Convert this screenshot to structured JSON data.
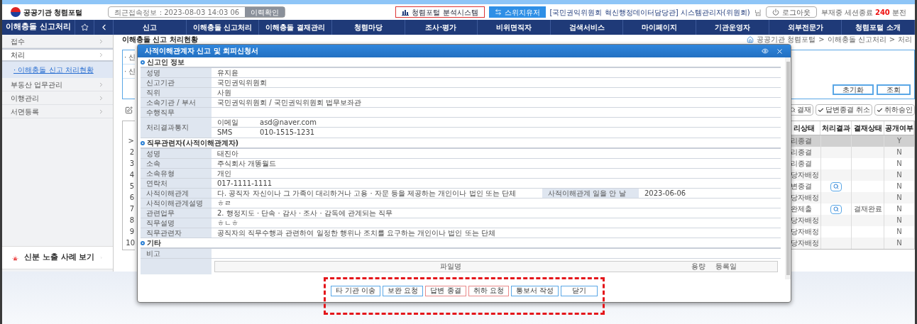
{
  "header": {
    "logo": "공공기관 청렴포털",
    "last_login": "최근접속정보 : 2023-08-03 14:03 06",
    "history_button": "이력확인",
    "analysis_button": "청렴포털 분석시스템",
    "switch_button": "스위치유저",
    "user": "[국민권익위원회 혁신행정데이터담당관] 시스템관리자(위원회)",
    "user_suffix": "님",
    "logout_button": "로그아웃",
    "session_prefix": "부재중 세션종료",
    "session_minutes": "240",
    "session_suffix": "분전"
  },
  "nav": {
    "section_title": "이해충돌 신고처리",
    "items": [
      "신고",
      "이해충돌 신고처리",
      "이해충돌 결재관리",
      "청렴마당",
      "조사·평가",
      "비위면직자",
      "검색서비스",
      "마이페이지",
      "기관운영자",
      "외부전문가",
      "청렴포털 소개"
    ]
  },
  "sidebar": {
    "items": [
      {
        "label": "접수",
        "selected": false
      },
      {
        "label": "처리",
        "selected": true,
        "children": [
          {
            "label": "· 이해충돌 신고 처리현황",
            "selected": true
          }
        ]
      },
      {
        "label": "부동산 업무관리",
        "selected": false
      },
      {
        "label": "이행관리",
        "selected": false
      },
      {
        "label": "서면등록",
        "selected": false
      }
    ],
    "exposure_link": "신분 노출 사례 보기"
  },
  "page": {
    "title": "이해충돌 신고 처리현황",
    "breadcrumb": [
      "공공기관 청렴포털",
      "이해충돌 신고처리",
      "처리"
    ],
    "separator": ">"
  },
  "search": {
    "labels": [
      "· 신",
      "· 신"
    ],
    "buttons": [
      "초기화",
      "조회"
    ]
  },
  "toolbar": [
    {
      "kind": "approve",
      "label": "결재"
    },
    {
      "kind": "check",
      "label": "답변종결 취소"
    },
    {
      "kind": "check",
      "label": "취하승인"
    }
  ],
  "table": {
    "columns": [
      "리상태",
      "처리결과",
      "결재상태",
      "공개여부"
    ],
    "rows": [
      {
        "number": ">",
        "status": "리종결",
        "has_result": false,
        "approval": "",
        "public": "Y",
        "selected": true
      },
      {
        "number": "2",
        "status": "리종결",
        "has_result": false,
        "public": "N",
        "selected": false
      },
      {
        "number": "3",
        "status": "리종결",
        "has_result": false,
        "public": "N",
        "selected": false
      },
      {
        "number": "4",
        "status": "당자배정",
        "has_result": false,
        "public": "N",
        "selected": false
      },
      {
        "number": "5",
        "status": "변종결",
        "has_result": true,
        "public": "N",
        "selected": false
      },
      {
        "number": "6",
        "status": "당자배정",
        "has_result": false,
        "public": "N",
        "selected": false
      },
      {
        "number": "7",
        "status": "완제출",
        "has_result": true,
        "approval": "결재완료",
        "public": "N",
        "selected": false
      },
      {
        "number": "8",
        "status": "당자배정",
        "has_result": false,
        "public": "N",
        "selected": false
      },
      {
        "number": "9",
        "status": "당자배정",
        "has_result": false,
        "public": "N",
        "selected": false
      },
      {
        "number": "10",
        "status": "당자배정",
        "has_result": false,
        "public": "N",
        "selected": false
      }
    ]
  },
  "modal": {
    "title": "사적이해관계자 신고 및 회피신청서",
    "sections": [
      {
        "title": "신고인 정보",
        "rows": [
          {
            "kind": "text",
            "label": "성명",
            "value": "유지윤"
          },
          {
            "kind": "text",
            "label": "신고기관",
            "value": "국민권익위원회"
          },
          {
            "kind": "text",
            "label": "직위",
            "value": "사원"
          },
          {
            "kind": "text",
            "label": "소속기관 / 부서",
            "value": "국민권익위원회 / 국민권익위원회 법무보좌관"
          },
          {
            "kind": "text",
            "label": "수행직무"
          },
          {
            "kind": "contact",
            "label": "처리결과통지",
            "items": [
              {
                "label": "이메일",
                "value": "asd@naver.com"
              },
              {
                "label": "SMS",
                "value": "010-1515-1231"
              }
            ]
          }
        ]
      },
      {
        "title": "직무관련자(사적이해관계자)",
        "rows": [
          {
            "kind": "text",
            "label": "성명",
            "value": "태진아"
          },
          {
            "kind": "text",
            "label": "소속",
            "value": "주식회사 개똥월드"
          },
          {
            "kind": "text",
            "label": "소속유형",
            "value": "개인"
          },
          {
            "kind": "text",
            "label": "연락처",
            "value": "017-1111-1111"
          },
          {
            "kind": "split",
            "label": "사적이해관계",
            "value": "다. 공직자 자신이나 그 가족이 대리하거나 고용 · 자문 등을 제공하는 개인이나 법인 또는 단체",
            "label2": "사적이해관계 일을 안 날",
            "value2": "2023-06-06"
          },
          {
            "kind": "text",
            "label": "사적이해관계설명",
            "value": "ㅎㄹ"
          },
          {
            "kind": "text",
            "label": "관련업무",
            "value": "2. 행정지도 · 단속 · 감사 · 조사 · 감독에 관계되는 직무"
          },
          {
            "kind": "text",
            "label": "직무설명",
            "value": "ㅎㄴㅎ"
          },
          {
            "kind": "text",
            "label": "직무관련자",
            "value": "공직자의 직무수행과 관련하여 일정한 행위나 조치를 요구하는 개인이나 법인 또는 단체"
          }
        ]
      },
      {
        "title": "기타",
        "rows": [
          {
            "kind": "text",
            "label": "비고"
          },
          {
            "kind": "file",
            "columns": [
              "파일명",
              "용량",
              "등록일"
            ]
          }
        ]
      }
    ],
    "buttons": [
      {
        "label": "타 기관 이송",
        "kind": "primary"
      },
      {
        "label": "보완 요청",
        "kind": "primary"
      },
      {
        "label": "답변 종결",
        "kind": "danger"
      },
      {
        "label": "취하 요청",
        "kind": "danger"
      },
      {
        "label": "통보서 작성",
        "kind": "primary"
      },
      {
        "label": "닫기",
        "kind": "primary"
      }
    ]
  }
}
